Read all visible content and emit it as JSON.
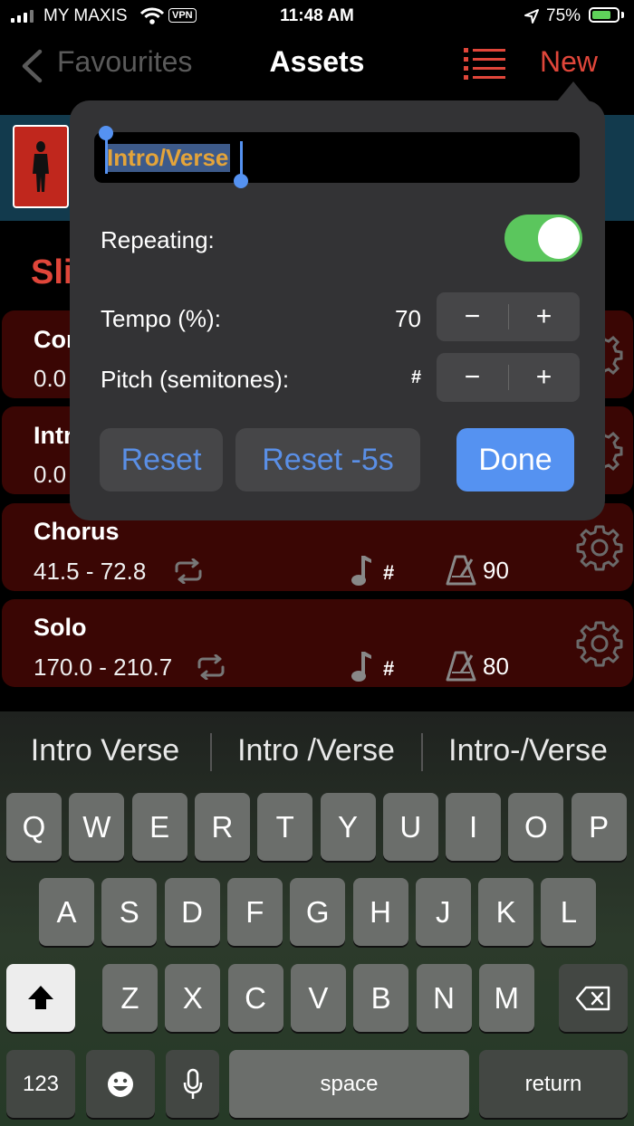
{
  "status_bar": {
    "carrier": "MY MAXIS",
    "vpn": "VPN",
    "time": "11:48 AM",
    "battery_percent": "75%",
    "battery_level": 0.75
  },
  "nav": {
    "back_label": "Favourites",
    "title": "Assets",
    "new_label": "New"
  },
  "background": {
    "section_title_partial": "Sli",
    "rows": [
      {
        "title": "Cor",
        "range": "0.0"
      },
      {
        "title": "Intr",
        "range": "0.0"
      },
      {
        "title": "Chorus",
        "range": "41.5 - 72.8",
        "pitch": "#",
        "tempo": "90"
      },
      {
        "title": "Solo",
        "range": "170.0 - 210.7",
        "pitch": "#",
        "tempo": "80"
      }
    ]
  },
  "popover": {
    "name_value": "Intro/Verse",
    "repeating_label": "Repeating:",
    "repeating_on": true,
    "tempo_label": "Tempo (%):",
    "tempo_value": "70",
    "pitch_label": "Pitch (semitones):",
    "pitch_value": "#",
    "minus_glyph": "−",
    "plus_glyph": "+",
    "reset_label": "Reset",
    "reset5_label": "Reset -5s",
    "done_label": "Done"
  },
  "keyboard": {
    "suggestions": [
      "Intro Verse",
      "Intro /Verse",
      "Intro-/Verse"
    ],
    "row1": [
      "Q",
      "W",
      "E",
      "R",
      "T",
      "Y",
      "U",
      "I",
      "O",
      "P"
    ],
    "row2": [
      "A",
      "S",
      "D",
      "F",
      "G",
      "H",
      "J",
      "K",
      "L"
    ],
    "row3": [
      "Z",
      "X",
      "C",
      "V",
      "B",
      "N",
      "M"
    ],
    "numbers_label": "123",
    "space_label": "space",
    "return_label": "return"
  },
  "colors": {
    "accent_red": "#e0463a",
    "blue": "#5592f1",
    "toggle_green": "#5bc65d",
    "name_text": "#e4a43a"
  }
}
